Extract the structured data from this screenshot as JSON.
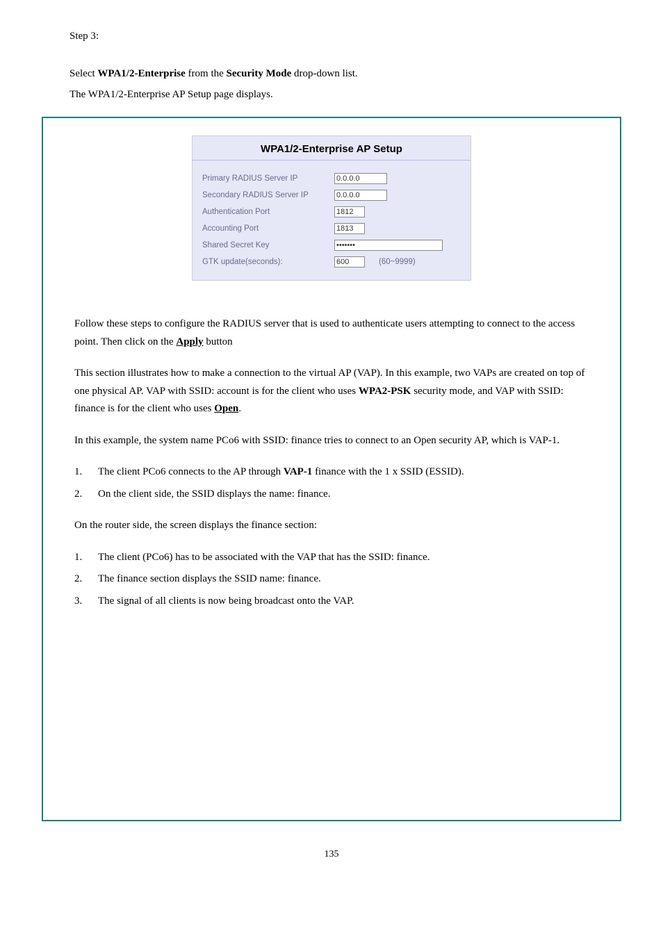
{
  "header": {
    "step_line": "Step 3:",
    "step_label_prefix": "Select",
    "step_label_bold": "WPA1/2-Enterprise",
    "step_label_mid": "from the",
    "step_label_bold2": "Security Mode",
    "step_label_suffix": "drop-down list.",
    "setup_title": "The WPA1/2-Enterprise AP Setup page displays."
  },
  "panel": {
    "title": "WPA1/2-Enterprise AP Setup",
    "rows": {
      "primary_radius_label": "Primary RADIUS Server IP",
      "primary_radius_value": "0.0.0.0",
      "secondary_radius_label": "Secondary RADIUS Server IP",
      "secondary_radius_value": "0.0.0.0",
      "auth_port_label": "Authentication Port",
      "auth_port_value": "1812",
      "acct_port_label": "Accounting Port",
      "acct_port_value": "1813",
      "shared_secret_label": "Shared Secret Key",
      "shared_secret_value": "•••••••",
      "gtk_label": "GTK update(seconds):",
      "gtk_value": "600",
      "gtk_hint": "(60~9999)"
    }
  },
  "below": {
    "para1_prefix": "Follow these steps to configure the RADIUS server that is used to authenticate users attempting to connect to the access point. Then click on the",
    "para1_apply": "Apply",
    "para1_suffix": "button",
    "para2": "This section illustrates how to make a connection to the virtual AP (VAP). In this example, two VAPs are created on top of one physical AP. VAP with SSID:",
    "para2_tail_prefix": "account is for the client who uses ",
    "para2_bold1": "WPA2-PSK",
    "para2_mid": "security mode, and VAP with SSID: finance is for the client who uses",
    "para2_underline": "Open",
    "para2_suffix": ".",
    "sect1": "In this example, the system name PCo6 with SSID: finance tries to connect to an Open security AP, which is VAP-1.",
    "sect1_n1": "1.",
    "sect1_t1_a": "The client PCo6 connects to the AP through",
    "sect1_t1_b": "VAP-1",
    "sect1_t1_c": "finance with the 1 x SSID (ESSID).",
    "sect1_n2": "2.",
    "sect1_t2": "On the client side, the SSID displays the name: finance.",
    "sect2": "On the router side, the screen displays the finance section:",
    "sect2_n1": "1.",
    "sect2_t1": "The client (PCo6) has to be associated with the VAP that has the SSID: finance.",
    "sect2_n2": "2.",
    "sect2_t2": "The finance section displays the SSID name: finance.",
    "sect2_n3": "3.",
    "sect2_t3": "The signal of all clients is now being broadcast onto the VAP."
  },
  "page_number": "135"
}
